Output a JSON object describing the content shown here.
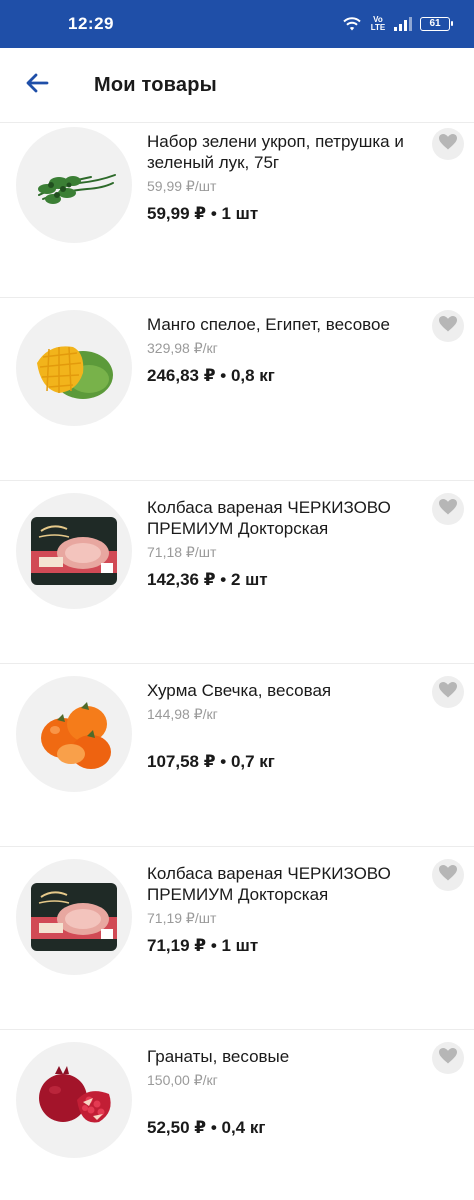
{
  "status_bar": {
    "time": "12:29",
    "volte": "Vo LTE",
    "battery": "61",
    "color": "#1f4fa8"
  },
  "header": {
    "title": "Мои товары",
    "back_icon": "arrow-left-icon",
    "accent": "#1f4fa8"
  },
  "products": [
    {
      "name": "Набор зелени укроп, петрушка и зеленый лук, 75г",
      "unit_price": "59,99 ₽/шт",
      "total": "59,99 ₽ • 1 шт",
      "image": "greens-image"
    },
    {
      "name": "Манго спелое, Египет, весовое",
      "unit_price": "329,98 ₽/кг",
      "total": "246,83 ₽ • 0,8 кг",
      "image": "mango-image"
    },
    {
      "name": "Колбаса вареная ЧЕРКИЗОВО ПРЕМИУМ Докторская",
      "unit_price": "71,18 ₽/шт",
      "total": "142,36 ₽ • 2 шт",
      "image": "sausage-pack-image"
    },
    {
      "name": "Хурма Свечка, весовая",
      "unit_price": "144,98 ₽/кг",
      "total": "107,58 ₽ • 0,7 кг",
      "image": "persimmon-image"
    },
    {
      "name": "Колбаса вареная ЧЕРКИЗОВО ПРЕМИУМ Докторская",
      "unit_price": "71,19 ₽/шт",
      "total": "71,19 ₽ • 1 шт",
      "image": "sausage-pack-image"
    },
    {
      "name": "Гранаты, весовые",
      "unit_price": "150,00 ₽/кг",
      "total": "52,50 ₽ • 0,4 кг",
      "image": "pomegranate-image"
    }
  ],
  "favorite_icon": "heart-icon"
}
